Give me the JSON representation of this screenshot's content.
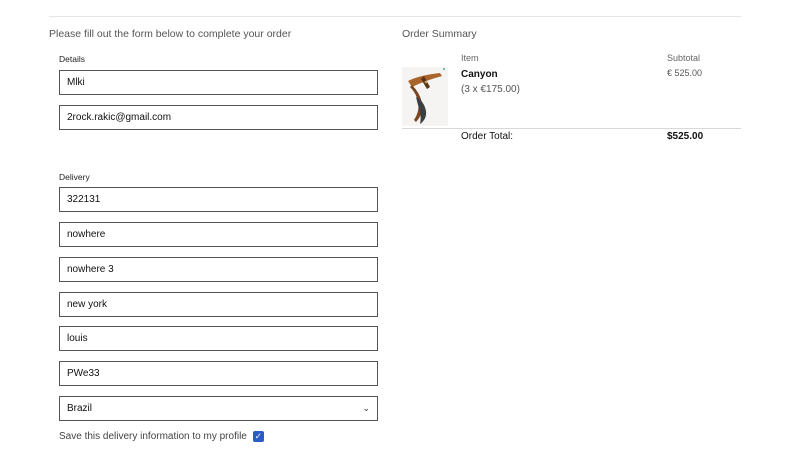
{
  "form": {
    "intro": "Please fill out the form below to complete your order",
    "details_label": "Details",
    "name_value": "Mlki",
    "email_value": "2rock.rakic@gmail.com",
    "delivery_label": "Delivery",
    "phone_value": "322131",
    "address1_value": "nowhere",
    "address2_value": "nowhere 3",
    "city_value": "new york",
    "county_value": "louis",
    "postcode_value": "PWe33",
    "country_value": "Brazil",
    "save_label": "Save this delivery information to my profile",
    "save_checked": true
  },
  "summary": {
    "title": "Order Summary",
    "item_header": "Item",
    "subtotal_header": "Subtotal",
    "item_name": "Canyon",
    "item_qty": "(3 x €175.00)",
    "item_subtotal": "€ 525.00",
    "total_label": "Order Total:",
    "total_value": "$525.00"
  },
  "icons": {
    "select": "chevron-down-icon",
    "checkbox": "check-icon",
    "product": "knife-image"
  },
  "colors": {
    "checkbox": "#2b5bc4",
    "field_border": "#555555"
  }
}
